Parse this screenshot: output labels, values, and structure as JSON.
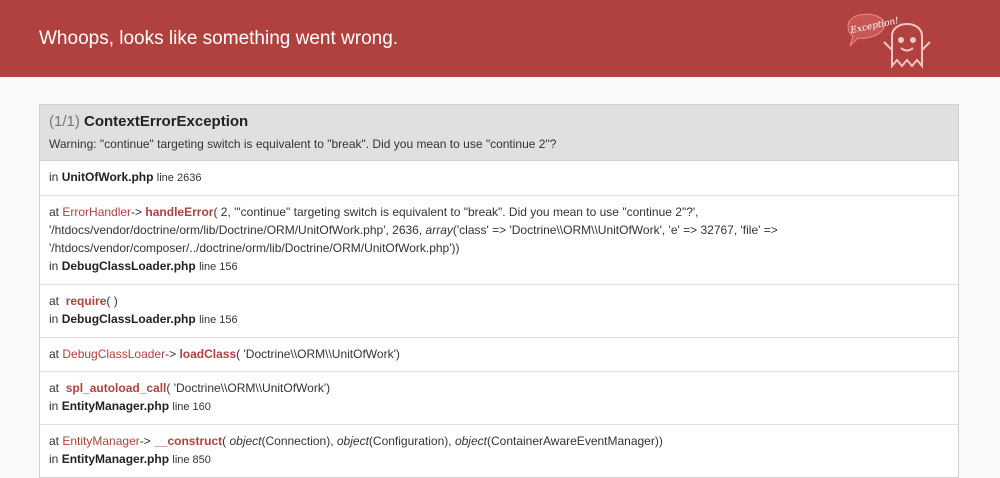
{
  "header": {
    "title": "Whoops, looks like something went wrong.",
    "logo_text": "Exception!"
  },
  "exception": {
    "count": "(1/1)",
    "class": "ContextErrorException",
    "message": "Warning: \"continue\" targeting switch is equivalent to \"break\". Did you mean to use \"continue 2\"?"
  },
  "trace": {
    "t0": {
      "in": "in",
      "file": "UnitOfWork.php",
      "line": "line 2636"
    },
    "t1": {
      "at": "at",
      "class": "ErrorHandler",
      "arrow": "->",
      "func": "handleError",
      "args_pre": "( 2, '\"continue\" targeting switch is equivalent to \"break\". Did you mean to use \"continue 2\"?', '/htdocs/vendor/doctrine/orm/lib/Doctrine/ORM/UnitOfWork.php', 2636, ",
      "args_em": "array",
      "args_post": "('class' => 'Doctrine\\\\ORM\\\\UnitOfWork', 'e' => 32767, 'file' => '/htdocs/vendor/composer/../doctrine/orm/lib/Doctrine/ORM/UnitOfWork.php'))",
      "in": "in",
      "file": "DebugClassLoader.php",
      "line": "line 156"
    },
    "t2": {
      "at": "at",
      "func": "require",
      "args": "( )",
      "in": "in",
      "file": "DebugClassLoader.php",
      "line": "line 156"
    },
    "t3": {
      "at": "at",
      "class": "DebugClassLoader",
      "arrow": "->",
      "func": "loadClass",
      "args": "( 'Doctrine\\\\ORM\\\\UnitOfWork')"
    },
    "t4": {
      "at": "at",
      "func": "spl_autoload_call",
      "args": "( 'Doctrine\\\\ORM\\\\UnitOfWork')",
      "in": "in",
      "file": "EntityManager.php",
      "line": "line 160"
    },
    "t5": {
      "at": "at",
      "class": "EntityManager",
      "arrow": "->",
      "func": "__construct",
      "open": "( ",
      "em1": "object",
      "a1": "(Connection), ",
      "em2": "object",
      "a2": "(Configuration), ",
      "em3": "object",
      "a3": "(ContainerAwareEventManager))",
      "in": "in",
      "file": "EntityManager.php",
      "line": "line 850"
    }
  }
}
